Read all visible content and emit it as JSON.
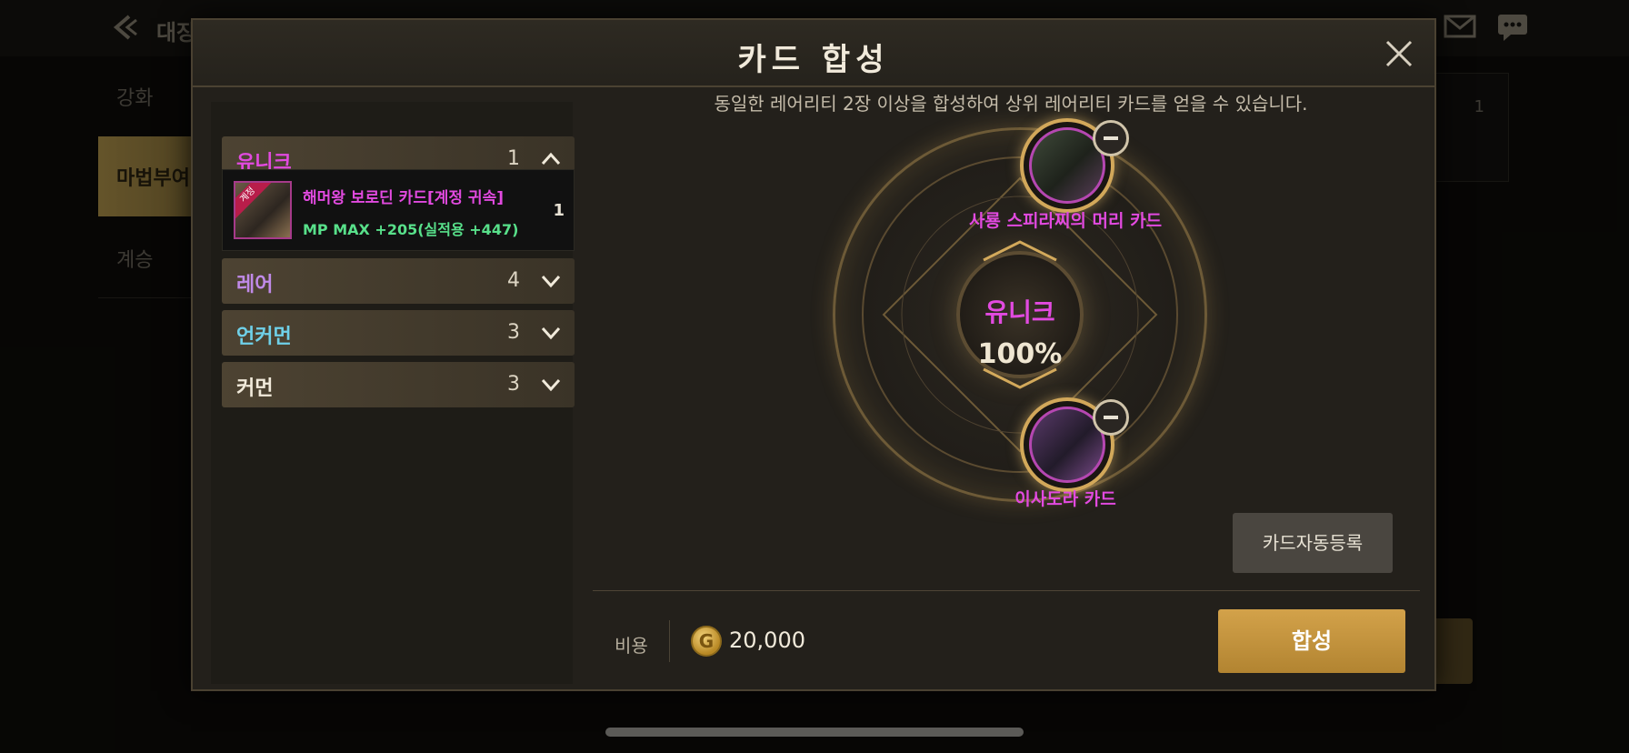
{
  "background": {
    "title": "대장",
    "side_items": [
      "강화",
      "마법부여",
      "계승"
    ],
    "right_panel_text": "",
    "right_panel_count": "1"
  },
  "modal": {
    "title": "카드 합성",
    "description": "동일한 레어리티 2장 이상을 합성하여 상위 레어리티 카드를 얻을 수 있습니다.",
    "grades": [
      {
        "label": "유니크",
        "count": "1",
        "color": "#e24ae0",
        "expanded": true
      },
      {
        "label": "레어",
        "count": "4",
        "color": "#c08ae8",
        "expanded": false
      },
      {
        "label": "언커먼",
        "count": "3",
        "color": "#6fd0e8",
        "expanded": false
      },
      {
        "label": "커먼",
        "count": "3",
        "color": "#f1eadb",
        "expanded": false
      }
    ],
    "card_item": {
      "name": "해머왕 보로딘 카드[계정 귀속]",
      "stat": "MP MAX +205(실적용 +447)",
      "count": "1",
      "ribbon": "계정"
    },
    "slots": [
      {
        "name": "사룡 스피라찌의 머리 카드"
      },
      {
        "name": "이사도라 카드"
      }
    ],
    "result": {
      "grade": "유니크",
      "chance": "100%"
    },
    "auto_register_label": "카드자동등록",
    "cost_label": "비용",
    "cost_value": "20,000",
    "coin_symbol": "G",
    "synth_label": "합성"
  }
}
